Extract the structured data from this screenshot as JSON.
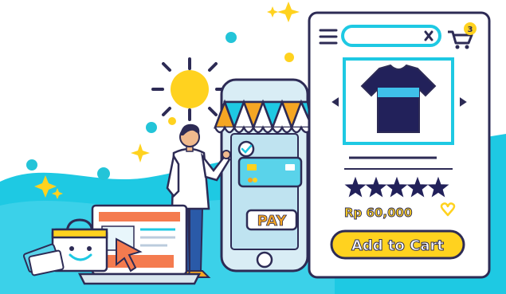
{
  "product_panel": {
    "search": {
      "value": "",
      "placeholder": ""
    },
    "cart_badge_count": "3",
    "rating": {
      "stars": 5,
      "max": 5
    },
    "price": "Rp 60,000",
    "add_to_cart_label": "Add to Cart"
  },
  "phone": {
    "pay_label": "PAY"
  },
  "colors": {
    "teal_wave": "#1ec9e3",
    "navy": "#2d2b55",
    "yellow": "#ffd21f",
    "orange": "#f5a623",
    "sun": "#ffd21f",
    "accent_teal": "#1fc2d6",
    "shirt_dark": "#22215a",
    "shirt_stripe": "#3fc0ea",
    "phone_body": "#d9edf5"
  },
  "icons": [
    "menu-icon",
    "close-icon",
    "cart-icon",
    "heart-icon",
    "arrow-left-icon",
    "arrow-right-icon",
    "star-icon",
    "check-icon",
    "sun-icon",
    "sparkle-icon",
    "cursor-icon"
  ]
}
